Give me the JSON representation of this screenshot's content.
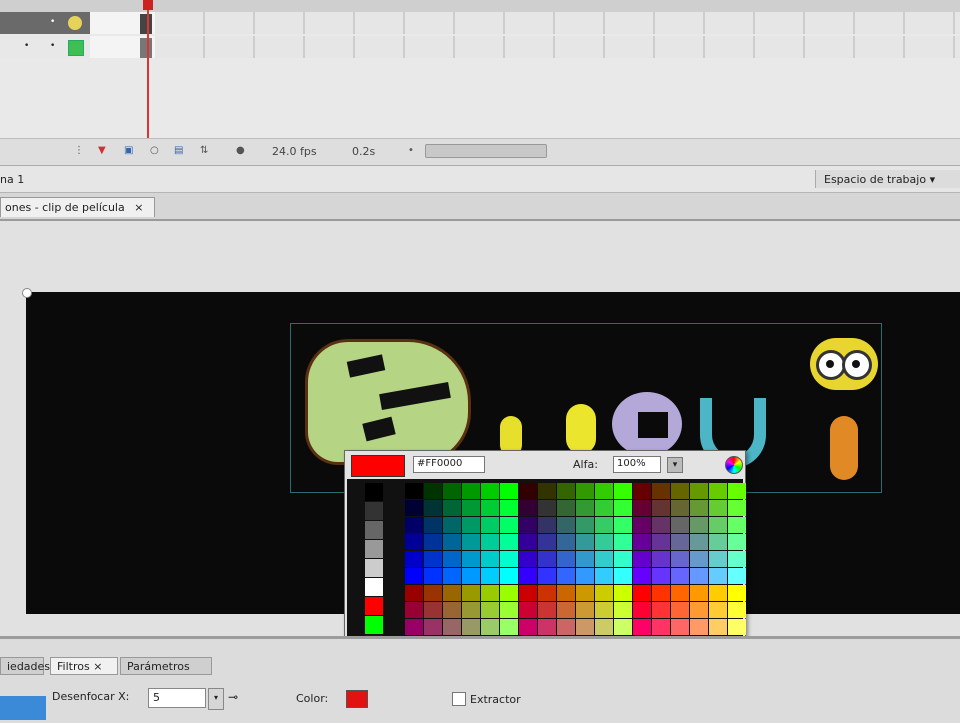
{
  "timeline": {
    "fps": "24.0 fps",
    "time": "0.2s"
  },
  "scene": {
    "label": "na 1",
    "workspace": "Espacio de trabajo ▾"
  },
  "document_tab": {
    "label": "ones - clip de película",
    "close": "×"
  },
  "color_picker": {
    "hex": "#FF0000",
    "alpha_label": "Alfa:",
    "alpha": "100%",
    "alpha_toggle": "▾"
  },
  "properties": {
    "tabs": [
      "iedades",
      "Filtros ×",
      "Parámetros"
    ],
    "blur_x_label": "Desenfocar X:",
    "blur_x_value": "5",
    "blur_dropdown": "▾",
    "link": "⊸",
    "color_label": "Color:",
    "knockout_label": "Extractor",
    "accent_color": "#3a8ad8",
    "filter_color": "#e21212"
  },
  "icons": [
    "gear-icon",
    "onion-skin-icon",
    "center-frame-icon",
    "color-wheel-icon",
    "link-icon"
  ]
}
